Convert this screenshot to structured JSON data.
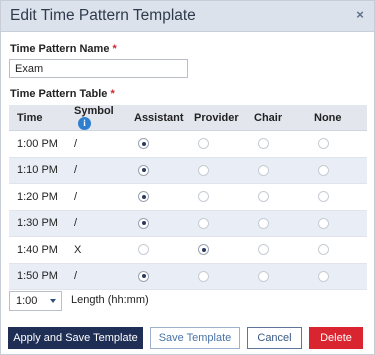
{
  "dialog": {
    "title": "Edit Time Pattern Template",
    "close_symbol": "×"
  },
  "name_field": {
    "label": "Time Pattern Name",
    "required_mark": "*",
    "value": "Exam"
  },
  "table_section": {
    "label": "Time Pattern Table",
    "required_mark": "*"
  },
  "table": {
    "headers": [
      "Time",
      "Symbol",
      "Assistant",
      "Provider",
      "Chair",
      "None"
    ],
    "info_icon_glyph": "i",
    "rows": [
      {
        "time": "1:00 PM",
        "symbol": "/",
        "selected": "Assistant"
      },
      {
        "time": "1:10 PM",
        "symbol": "/",
        "selected": "Assistant"
      },
      {
        "time": "1:20 PM",
        "symbol": "/",
        "selected": "Assistant"
      },
      {
        "time": "1:30 PM",
        "symbol": "/",
        "selected": "Assistant"
      },
      {
        "time": "1:40 PM",
        "symbol": "X",
        "selected": "Provider"
      },
      {
        "time": "1:50 PM",
        "symbol": "/",
        "selected": "Assistant"
      }
    ]
  },
  "length": {
    "selected": "1:00",
    "label": "Length (hh:mm)"
  },
  "buttons": {
    "apply": "Apply and Save Template",
    "save": "Save Template",
    "cancel": "Cancel",
    "delete": "Delete"
  },
  "colors": {
    "title_bar": "#dbe2ec",
    "primary": "#1e2e55",
    "danger": "#d9252f",
    "row_alt": "#e9eef6",
    "info": "#2f7fd0"
  }
}
